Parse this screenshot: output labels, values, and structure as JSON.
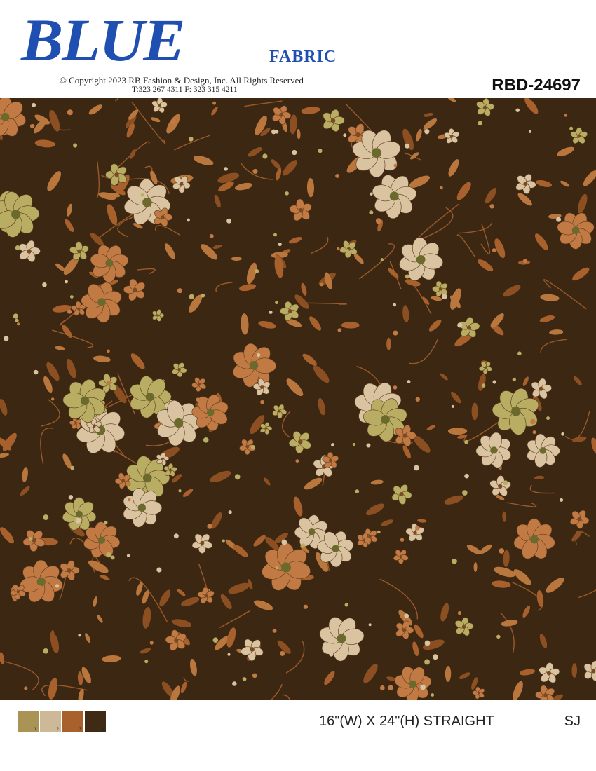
{
  "header": {
    "logo_word": "BLUE",
    "logo_sub": "FABRIC",
    "copyright": "© Copyright   2023 RB Fashion & Design, Inc. All Rights Reserved",
    "phones": "T:323 267 4311   F: 323 315 4211",
    "design_code": "RBD-24697"
  },
  "colors": {
    "brand_blue": "#1f4fb0",
    "ground": "#3c2713",
    "leaf_rust": "#a8602c",
    "flower_cream": "#d9c3a0",
    "flower_olive": "#b8ad62",
    "flower_rust": "#c27a45"
  },
  "swatches": [
    {
      "number": "1",
      "color": "#a99455"
    },
    {
      "number": "2",
      "color": "#cdb898"
    },
    {
      "number": "3",
      "color": "#a8602c"
    },
    {
      "number": "4",
      "color": "#3f2a16"
    }
  ],
  "footer": {
    "repeat_size": "16\"(W) X 24\"(H) STRAIGHT",
    "initials": "SJ"
  }
}
